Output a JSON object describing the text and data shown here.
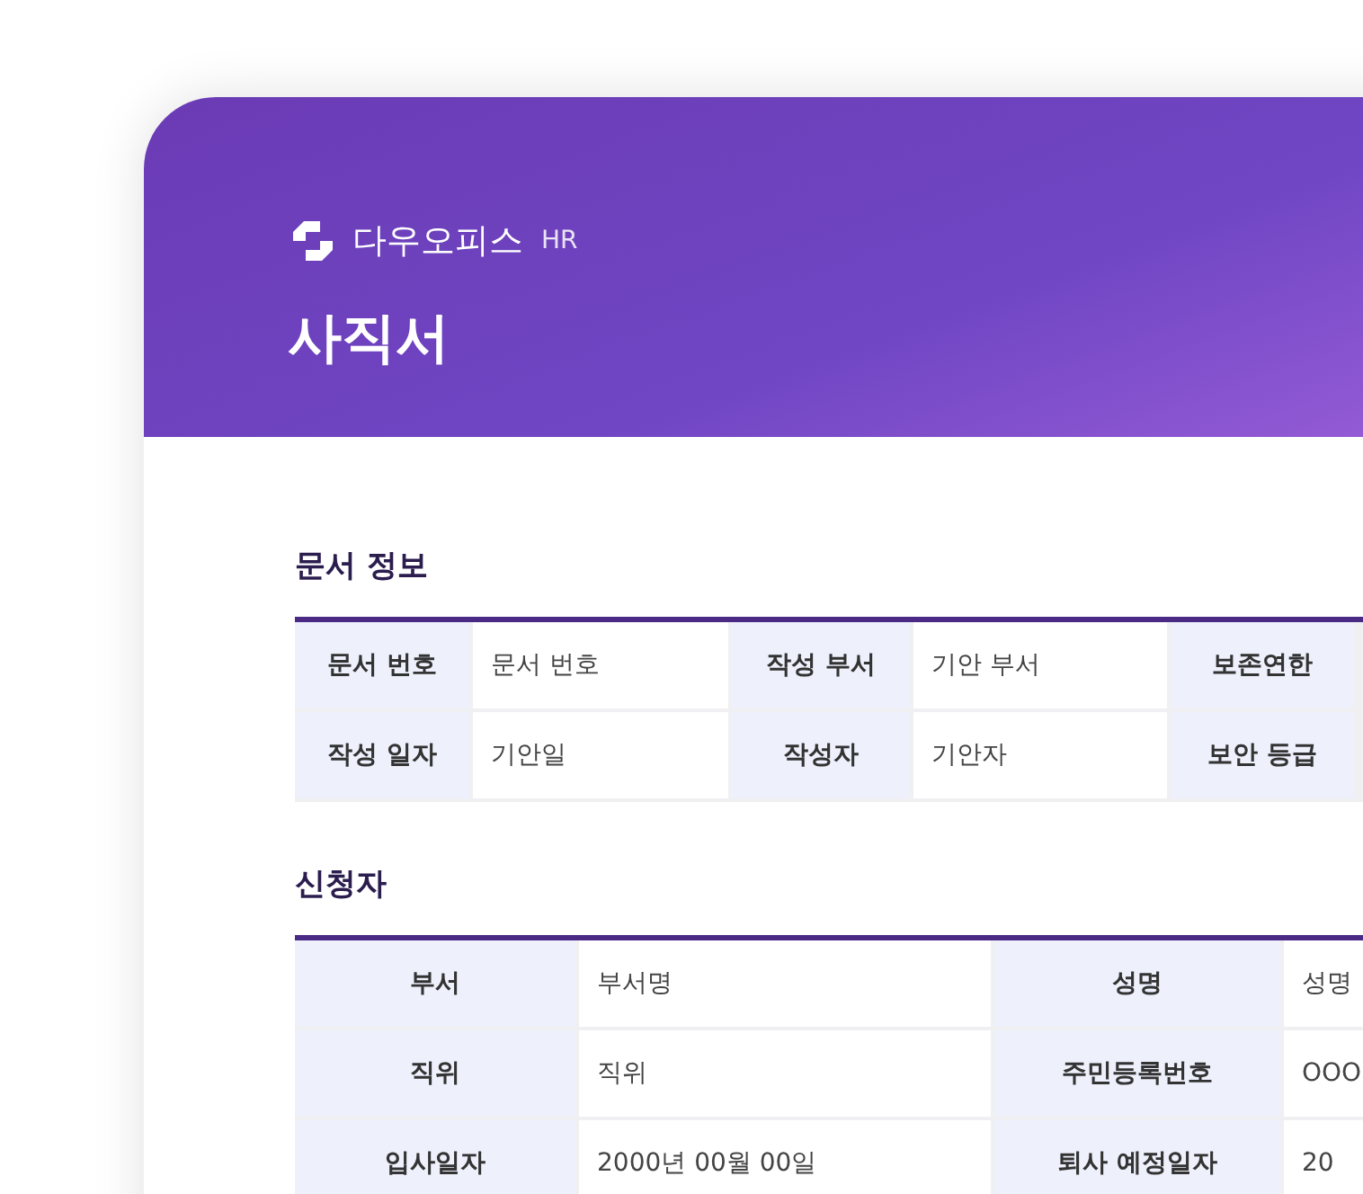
{
  "header": {
    "brand": "다우오피스",
    "brand_suffix": "HR",
    "title": "사직서"
  },
  "sections": [
    {
      "title": "문서 정보",
      "rows": [
        [
          {
            "kind": "label",
            "text": "문서 번호"
          },
          {
            "kind": "value",
            "text": "문서 번호"
          },
          {
            "kind": "label",
            "text": "작성 부서"
          },
          {
            "kind": "value",
            "text": "기안 부서"
          },
          {
            "kind": "label",
            "text": "보존연한"
          }
        ],
        [
          {
            "kind": "label",
            "text": "작성 일자"
          },
          {
            "kind": "value",
            "text": "기안일"
          },
          {
            "kind": "label",
            "text": "작성자"
          },
          {
            "kind": "value",
            "text": "기안자"
          },
          {
            "kind": "label",
            "text": "보안 등급"
          }
        ]
      ]
    },
    {
      "title": "신청자",
      "rows": [
        [
          {
            "kind": "label",
            "text": "부서"
          },
          {
            "kind": "value",
            "text": "부서명"
          },
          {
            "kind": "label",
            "text": "성명"
          },
          {
            "kind": "value",
            "text": "성명"
          }
        ],
        [
          {
            "kind": "label",
            "text": "직위"
          },
          {
            "kind": "value",
            "text": "직위"
          },
          {
            "kind": "label",
            "text": "주민등록번호"
          },
          {
            "kind": "value",
            "text": "OOO"
          }
        ],
        [
          {
            "kind": "label",
            "text": "입사일자"
          },
          {
            "kind": "value",
            "text": "2000년 00월 00일"
          },
          {
            "kind": "label",
            "text": "퇴사 예정일자"
          },
          {
            "kind": "value",
            "text": "20"
          }
        ]
      ]
    }
  ]
}
